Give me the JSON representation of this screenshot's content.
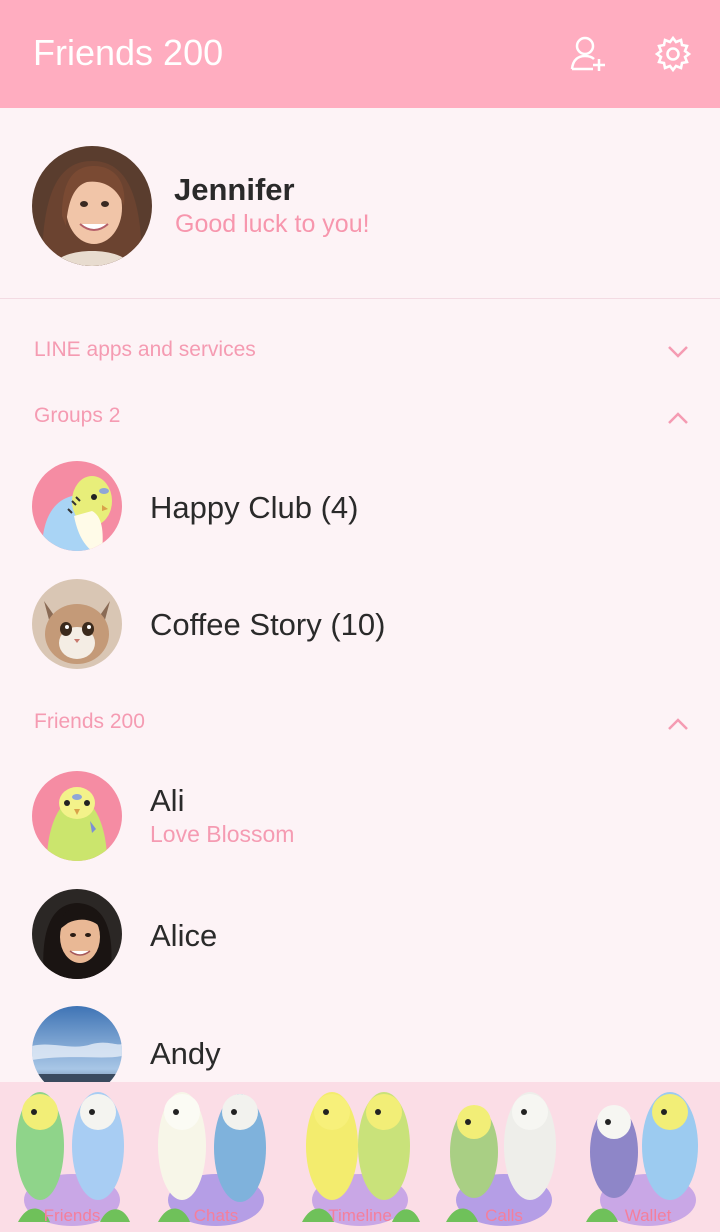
{
  "header": {
    "title": "Friends 200",
    "add_friend_icon": "add-friend-icon",
    "settings_icon": "gear-icon"
  },
  "profile": {
    "name": "Jennifer",
    "status": "Good luck to you!"
  },
  "sections": {
    "services": {
      "label": "LINE apps and services",
      "state": "collapsed"
    },
    "groups": {
      "label": "Groups 2",
      "state": "expanded"
    },
    "friends": {
      "label": "Friends 200",
      "state": "expanded"
    }
  },
  "groups": [
    {
      "name": "Happy Club (4)"
    },
    {
      "name": "Coffee Story (10)"
    }
  ],
  "friends": [
    {
      "name": "Ali",
      "status": "Love Blossom"
    },
    {
      "name": "Alice",
      "status": ""
    },
    {
      "name": "Andy",
      "status": ""
    }
  ],
  "tabs": [
    {
      "label": "Friends",
      "selected": true
    },
    {
      "label": "Chats",
      "selected": false
    },
    {
      "label": "Timeline",
      "selected": false
    },
    {
      "label": "Calls",
      "selected": false
    },
    {
      "label": "Wallet",
      "selected": false
    }
  ],
  "colors": {
    "header": "#ffadc0",
    "accent": "#f59bb2",
    "background": "#fdf3f6",
    "tabbar": "#fbdde6"
  }
}
